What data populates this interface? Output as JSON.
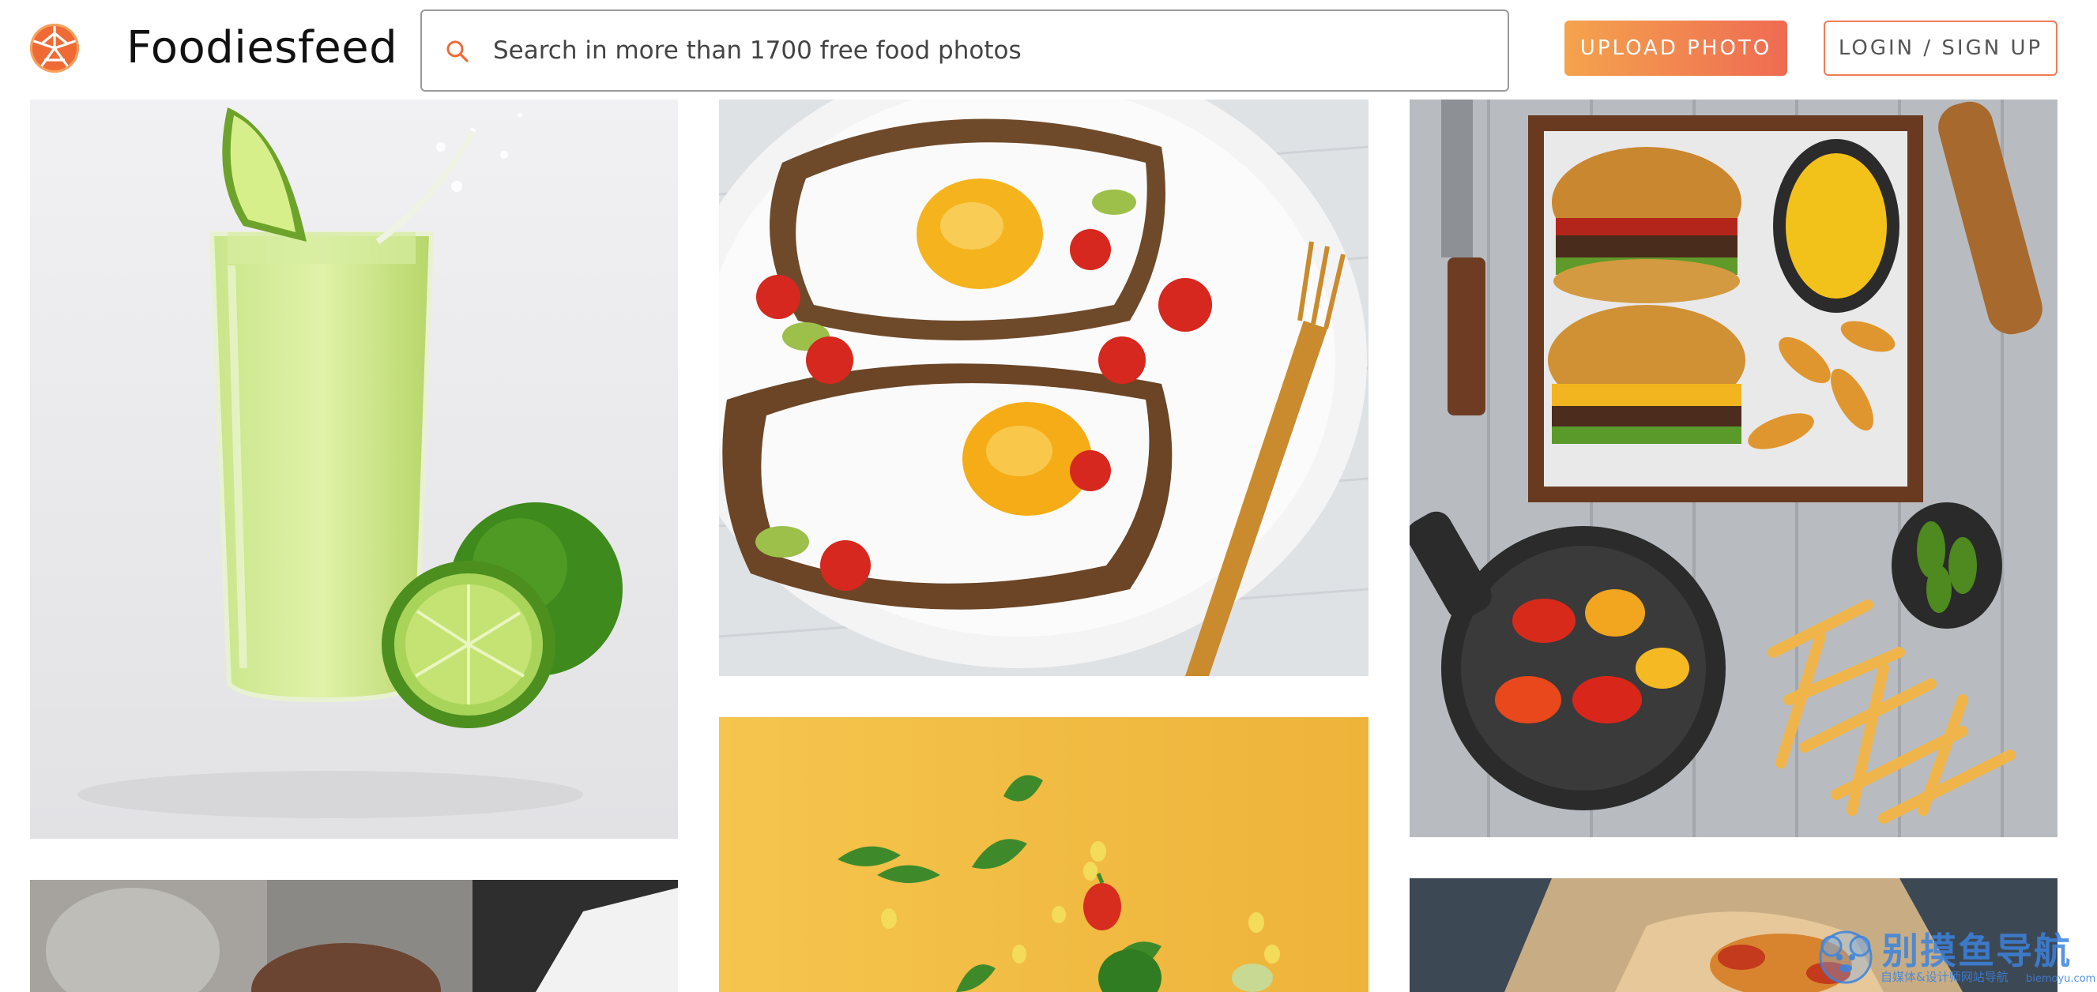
{
  "header": {
    "brand": "Foodiesfeed",
    "search_placeholder": "Search in more than 1700 free food photos",
    "upload_label": "UPLOAD PHOTO",
    "login_label": "LOGIN / SIGN UP"
  },
  "colors": {
    "accent_orange": "#f06a35",
    "upload_gradient_start": "#f4a34e",
    "upload_gradient_end": "#ef6b52",
    "login_border": "#ef7c55"
  },
  "photos": [
    {
      "subject": "lime juice glass with lime halves"
    },
    {
      "subject": "fried egg avocado toast on plate"
    },
    {
      "subject": "burgers, fries and grilled peppers on wooden table"
    },
    {
      "subject": "food on dark table (partially visible)"
    },
    {
      "subject": "flying tomatoes, basil and corn on yellow background"
    },
    {
      "subject": "pizza on parchment (partially visible)"
    }
  ],
  "watermark": {
    "title": "别摸鱼导航",
    "subtitle": "自媒体&设计师网站导航",
    "url": "biemoyu.com"
  }
}
